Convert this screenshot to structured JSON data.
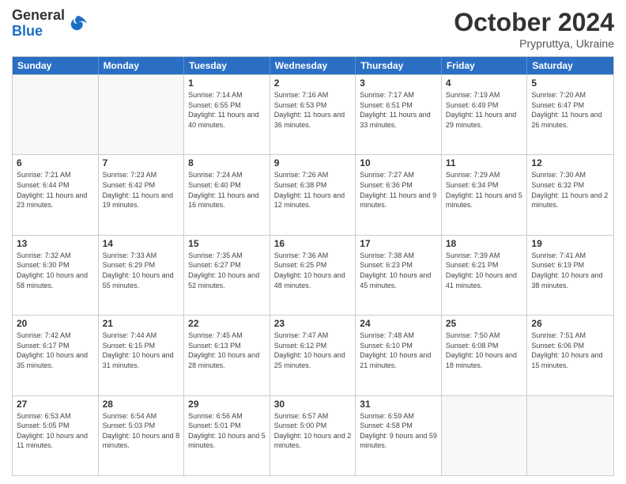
{
  "header": {
    "logo_general": "General",
    "logo_blue": "Blue",
    "month_title": "October 2024",
    "subtitle": "Prypruttya, Ukraine"
  },
  "weekdays": [
    "Sunday",
    "Monday",
    "Tuesday",
    "Wednesday",
    "Thursday",
    "Friday",
    "Saturday"
  ],
  "rows": [
    [
      {
        "day": "",
        "sunrise": "",
        "sunset": "",
        "daylight": "",
        "empty": true
      },
      {
        "day": "",
        "sunrise": "",
        "sunset": "",
        "daylight": "",
        "empty": true
      },
      {
        "day": "1",
        "sunrise": "Sunrise: 7:14 AM",
        "sunset": "Sunset: 6:55 PM",
        "daylight": "Daylight: 11 hours and 40 minutes.",
        "empty": false
      },
      {
        "day": "2",
        "sunrise": "Sunrise: 7:16 AM",
        "sunset": "Sunset: 6:53 PM",
        "daylight": "Daylight: 11 hours and 36 minutes.",
        "empty": false
      },
      {
        "day": "3",
        "sunrise": "Sunrise: 7:17 AM",
        "sunset": "Sunset: 6:51 PM",
        "daylight": "Daylight: 11 hours and 33 minutes.",
        "empty": false
      },
      {
        "day": "4",
        "sunrise": "Sunrise: 7:19 AM",
        "sunset": "Sunset: 6:49 PM",
        "daylight": "Daylight: 11 hours and 29 minutes.",
        "empty": false
      },
      {
        "day": "5",
        "sunrise": "Sunrise: 7:20 AM",
        "sunset": "Sunset: 6:47 PM",
        "daylight": "Daylight: 11 hours and 26 minutes.",
        "empty": false
      }
    ],
    [
      {
        "day": "6",
        "sunrise": "Sunrise: 7:21 AM",
        "sunset": "Sunset: 6:44 PM",
        "daylight": "Daylight: 11 hours and 23 minutes.",
        "empty": false
      },
      {
        "day": "7",
        "sunrise": "Sunrise: 7:23 AM",
        "sunset": "Sunset: 6:42 PM",
        "daylight": "Daylight: 11 hours and 19 minutes.",
        "empty": false
      },
      {
        "day": "8",
        "sunrise": "Sunrise: 7:24 AM",
        "sunset": "Sunset: 6:40 PM",
        "daylight": "Daylight: 11 hours and 16 minutes.",
        "empty": false
      },
      {
        "day": "9",
        "sunrise": "Sunrise: 7:26 AM",
        "sunset": "Sunset: 6:38 PM",
        "daylight": "Daylight: 11 hours and 12 minutes.",
        "empty": false
      },
      {
        "day": "10",
        "sunrise": "Sunrise: 7:27 AM",
        "sunset": "Sunset: 6:36 PM",
        "daylight": "Daylight: 11 hours and 9 minutes.",
        "empty": false
      },
      {
        "day": "11",
        "sunrise": "Sunrise: 7:29 AM",
        "sunset": "Sunset: 6:34 PM",
        "daylight": "Daylight: 11 hours and 5 minutes.",
        "empty": false
      },
      {
        "day": "12",
        "sunrise": "Sunrise: 7:30 AM",
        "sunset": "Sunset: 6:32 PM",
        "daylight": "Daylight: 11 hours and 2 minutes.",
        "empty": false
      }
    ],
    [
      {
        "day": "13",
        "sunrise": "Sunrise: 7:32 AM",
        "sunset": "Sunset: 6:30 PM",
        "daylight": "Daylight: 10 hours and 58 minutes.",
        "empty": false
      },
      {
        "day": "14",
        "sunrise": "Sunrise: 7:33 AM",
        "sunset": "Sunset: 6:29 PM",
        "daylight": "Daylight: 10 hours and 55 minutes.",
        "empty": false
      },
      {
        "day": "15",
        "sunrise": "Sunrise: 7:35 AM",
        "sunset": "Sunset: 6:27 PM",
        "daylight": "Daylight: 10 hours and 52 minutes.",
        "empty": false
      },
      {
        "day": "16",
        "sunrise": "Sunrise: 7:36 AM",
        "sunset": "Sunset: 6:25 PM",
        "daylight": "Daylight: 10 hours and 48 minutes.",
        "empty": false
      },
      {
        "day": "17",
        "sunrise": "Sunrise: 7:38 AM",
        "sunset": "Sunset: 6:23 PM",
        "daylight": "Daylight: 10 hours and 45 minutes.",
        "empty": false
      },
      {
        "day": "18",
        "sunrise": "Sunrise: 7:39 AM",
        "sunset": "Sunset: 6:21 PM",
        "daylight": "Daylight: 10 hours and 41 minutes.",
        "empty": false
      },
      {
        "day": "19",
        "sunrise": "Sunrise: 7:41 AM",
        "sunset": "Sunset: 6:19 PM",
        "daylight": "Daylight: 10 hours and 38 minutes.",
        "empty": false
      }
    ],
    [
      {
        "day": "20",
        "sunrise": "Sunrise: 7:42 AM",
        "sunset": "Sunset: 6:17 PM",
        "daylight": "Daylight: 10 hours and 35 minutes.",
        "empty": false
      },
      {
        "day": "21",
        "sunrise": "Sunrise: 7:44 AM",
        "sunset": "Sunset: 6:15 PM",
        "daylight": "Daylight: 10 hours and 31 minutes.",
        "empty": false
      },
      {
        "day": "22",
        "sunrise": "Sunrise: 7:45 AM",
        "sunset": "Sunset: 6:13 PM",
        "daylight": "Daylight: 10 hours and 28 minutes.",
        "empty": false
      },
      {
        "day": "23",
        "sunrise": "Sunrise: 7:47 AM",
        "sunset": "Sunset: 6:12 PM",
        "daylight": "Daylight: 10 hours and 25 minutes.",
        "empty": false
      },
      {
        "day": "24",
        "sunrise": "Sunrise: 7:48 AM",
        "sunset": "Sunset: 6:10 PM",
        "daylight": "Daylight: 10 hours and 21 minutes.",
        "empty": false
      },
      {
        "day": "25",
        "sunrise": "Sunrise: 7:50 AM",
        "sunset": "Sunset: 6:08 PM",
        "daylight": "Daylight: 10 hours and 18 minutes.",
        "empty": false
      },
      {
        "day": "26",
        "sunrise": "Sunrise: 7:51 AM",
        "sunset": "Sunset: 6:06 PM",
        "daylight": "Daylight: 10 hours and 15 minutes.",
        "empty": false
      }
    ],
    [
      {
        "day": "27",
        "sunrise": "Sunrise: 6:53 AM",
        "sunset": "Sunset: 5:05 PM",
        "daylight": "Daylight: 10 hours and 11 minutes.",
        "empty": false
      },
      {
        "day": "28",
        "sunrise": "Sunrise: 6:54 AM",
        "sunset": "Sunset: 5:03 PM",
        "daylight": "Daylight: 10 hours and 8 minutes.",
        "empty": false
      },
      {
        "day": "29",
        "sunrise": "Sunrise: 6:56 AM",
        "sunset": "Sunset: 5:01 PM",
        "daylight": "Daylight: 10 hours and 5 minutes.",
        "empty": false
      },
      {
        "day": "30",
        "sunrise": "Sunrise: 6:57 AM",
        "sunset": "Sunset: 5:00 PM",
        "daylight": "Daylight: 10 hours and 2 minutes.",
        "empty": false
      },
      {
        "day": "31",
        "sunrise": "Sunrise: 6:59 AM",
        "sunset": "Sunset: 4:58 PM",
        "daylight": "Daylight: 9 hours and 59 minutes.",
        "empty": false
      },
      {
        "day": "",
        "sunrise": "",
        "sunset": "",
        "daylight": "",
        "empty": true
      },
      {
        "day": "",
        "sunrise": "",
        "sunset": "",
        "daylight": "",
        "empty": true
      }
    ]
  ]
}
